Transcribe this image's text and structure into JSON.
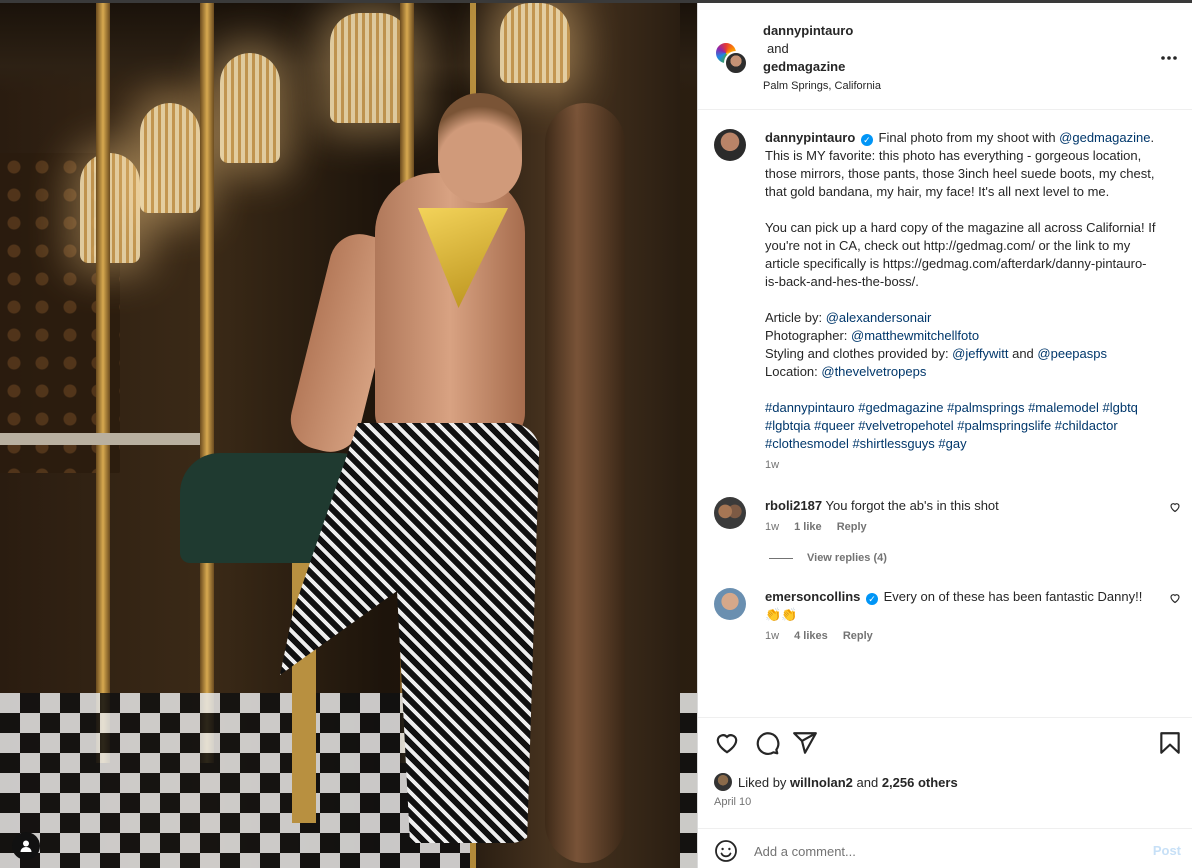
{
  "header": {
    "user1": "dannypintauro",
    "and": "and",
    "user2": "gedmagazine",
    "location": "Palm Springs, California"
  },
  "caption": {
    "username": "dannypintauro",
    "p1_pre": "Final photo from my shoot with ",
    "p1_mention": "@gedmagazine",
    "p1_post": ". This is MY favorite: this photo has everything - gorgeous location, those mirrors, those pants, those 3inch heel suede boots, my chest, that gold bandana, my hair, my face! It's all next level to me.",
    "p2": "You can pick up a hard copy of the magazine all across California! If you're not in CA, check out http://gedmag.com/ or the link to my article specifically is https://gedmag.com/afterdark/danny-pintauro-is-back-and-hes-the-boss/.",
    "article_label": "Article by: ",
    "article_mention": "@alexandersonair",
    "photographer_label": "Photographer: ",
    "photographer_mention": "@matthewmitchellfoto",
    "styling_label": "Styling and clothes provided by: ",
    "styling_mention1": "@jeffywitt",
    "styling_and": " and ",
    "styling_mention2": "@peepasps",
    "location_label": "Location: ",
    "location_mention": "@thevelvetropeps",
    "hashtags": "#dannypintauro #gedmagazine #palmsprings #malemodel #lgbtq #lgbtqia #queer #velvetropehotel #palmspringslife #childactor #clothesmodel #shirtlessguys #gay",
    "time": "1w"
  },
  "comments": [
    {
      "username": "rboli2187",
      "text": "You forgot the ab's in this shot",
      "time": "1w",
      "likes": "1 like",
      "reply": "Reply",
      "view_replies": "View replies (4)"
    },
    {
      "username": "emersoncollins",
      "text": "Every on of these has been fantastic Danny!! 👏👏",
      "time": "1w",
      "likes": "4 likes",
      "reply": "Reply"
    }
  ],
  "likes": {
    "prefix": "Liked by ",
    "user": "willnolan2",
    "mid": " and ",
    "count": "2,256 others"
  },
  "date": "April 10",
  "add_comment": {
    "placeholder": "Add a comment...",
    "post_label": "Post"
  },
  "colors": {
    "link": "#00376b",
    "verified": "#0095f6",
    "muted": "#737373"
  }
}
